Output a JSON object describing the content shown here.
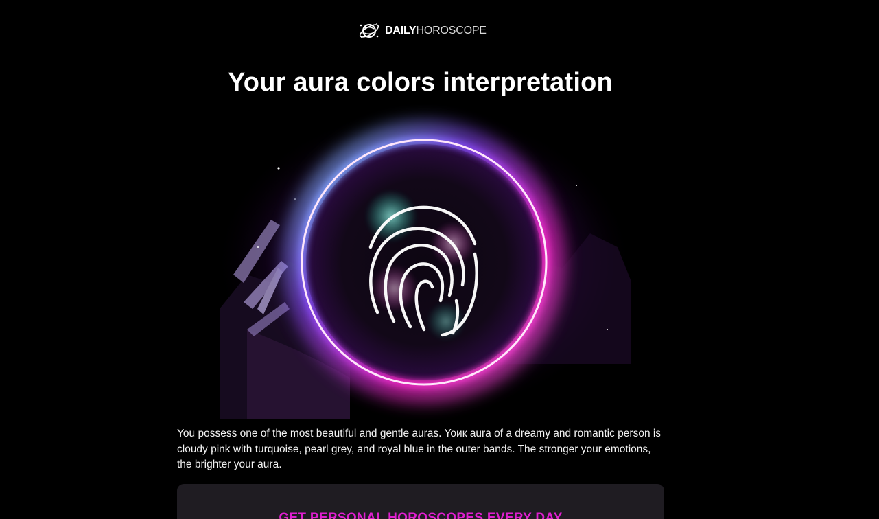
{
  "logo": {
    "icon": "globe-orbit-icon",
    "text_bold": "DAILY",
    "text_light": "HOROSCOPE"
  },
  "title": "Your aura colors interpretation",
  "illustration": {
    "icon": "fingerprint-icon",
    "ring_colors": [
      "#7a3cff",
      "#ff2bd0",
      "#ffffff"
    ]
  },
  "description": "You possess one of the most beautiful and gentle auras. Yoик aura of a dreamy and romantic person is cloudy pink with turquoise, pearl grey, and royal blue in the outer bands. The stronger your emotions, the brighter your aura.",
  "cta": {
    "heading": "GET PERSONAL HOROSCOPES EVERY DAY"
  },
  "colors": {
    "background": "#000000",
    "card_background": "#1f1c22",
    "accent": "#e01ed0"
  }
}
